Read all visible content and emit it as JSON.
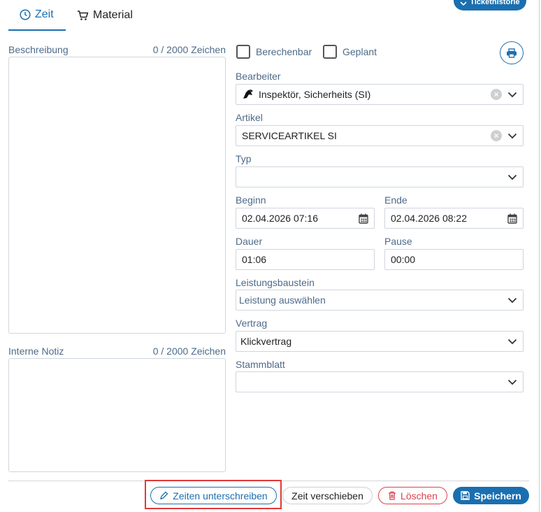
{
  "header": {
    "history_button_label": "Tickethistorie"
  },
  "tabs": [
    {
      "label": "Zeit",
      "icon": "clock-icon",
      "active": true
    },
    {
      "label": "Material",
      "icon": "cart-icon",
      "active": false
    }
  ],
  "description": {
    "label": "Beschreibung",
    "counter": "0 / 2000 Zeichen",
    "value": ""
  },
  "internal_note": {
    "label": "Interne Notiz",
    "counter": "0 / 2000 Zeichen",
    "value": ""
  },
  "checkboxes": {
    "billable": {
      "label": "Berechenbar",
      "checked": false
    },
    "planned": {
      "label": "Geplant",
      "checked": false
    }
  },
  "form": {
    "editor": {
      "label": "Bearbeiter",
      "value": "Inspektör, Sicherheits (SI)"
    },
    "article": {
      "label": "Artikel",
      "value": "SERVICEARTIKEL SI"
    },
    "type": {
      "label": "Typ",
      "value": ""
    },
    "start": {
      "label": "Beginn",
      "value": "02.04.2026 07:16"
    },
    "end": {
      "label": "Ende",
      "value": "02.04.2026 08:22"
    },
    "duration": {
      "label": "Dauer",
      "value": "01:06"
    },
    "pause": {
      "label": "Pause",
      "value": "00:00"
    },
    "service_module": {
      "label": "Leistungsbaustein",
      "placeholder": "Leistung auswählen"
    },
    "contract": {
      "label": "Vertrag",
      "value": "Klickvertrag"
    },
    "master_sheet": {
      "label": "Stammblatt",
      "value": ""
    }
  },
  "footer": {
    "sign_label": "Zeiten unterschreiben",
    "move_label": "Zeit verschieben",
    "delete_label": "Löschen",
    "save_label": "Speichern"
  },
  "colors": {
    "accent": "#1a6fb0",
    "danger": "#d9434f",
    "label": "#4e6a8a",
    "highlight": "#e03a3a"
  }
}
